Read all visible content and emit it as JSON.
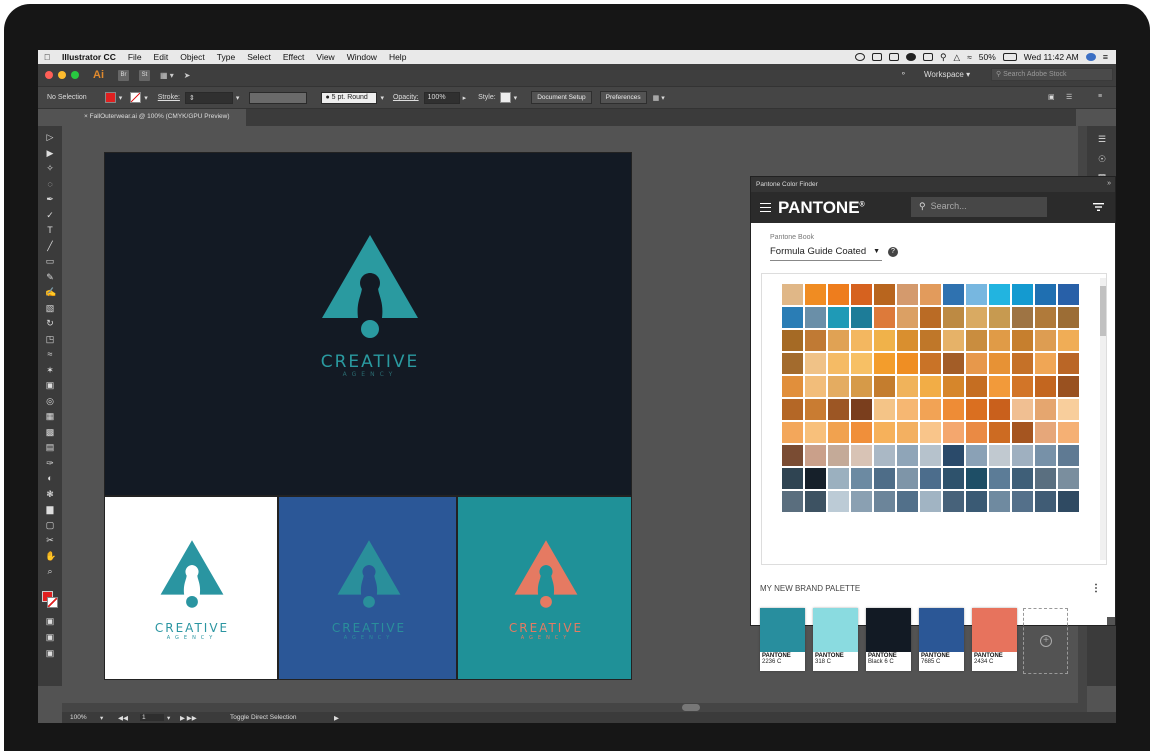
{
  "menubar": {
    "app": "Illustrator CC",
    "items": [
      "File",
      "Edit",
      "Object",
      "Type",
      "Select",
      "Effect",
      "View",
      "Window",
      "Help"
    ],
    "battery": "50%",
    "clock": "Wed 11:42 AM"
  },
  "appbar": {
    "logo": "Ai",
    "icons": [
      "Br",
      "St"
    ],
    "workspace": "Workspace",
    "search_placeholder": "Search Adobe Stock"
  },
  "control": {
    "selection": "No Selection",
    "stroke_label": "Stroke:",
    "brush": "5 pt. Round",
    "opacity_label": "Opacity:",
    "opacity_value": "100%",
    "style_label": "Style:",
    "doc_setup": "Document Setup",
    "preferences": "Preferences",
    "fill_color": "#e02020"
  },
  "doc_tab": "FallOuterwear.ai @ 100% (CMYK/GPU Preview)",
  "status": {
    "zoom": "100%",
    "page": "1",
    "tool": "Toggle Direct Selection"
  },
  "logo": {
    "word": "CREATIVE",
    "sub": "AGENCY"
  },
  "artboards": {
    "main_bg": "#131a24",
    "main_logo": "#2a9aa0",
    "variants": [
      {
        "bg": "#ffffff",
        "logo": "#2a95a1"
      },
      {
        "bg": "#2b5797",
        "logo": "#2a8f9b"
      },
      {
        "bg": "#1f9198",
        "logo": "#e57a62"
      }
    ]
  },
  "pantone": {
    "panel_title": "Pantone Color Finder",
    "brand": "PANTONE",
    "search_placeholder": "Search...",
    "book_label": "Pantone Book",
    "book_value": "Formula Guide Coated",
    "palette_title": "MY NEW BRAND PALETTE",
    "palette": [
      {
        "brand": "PANTONE",
        "code": "2236 C",
        "color": "#288e9e"
      },
      {
        "brand": "PANTONE",
        "code": "318 C",
        "color": "#8adbe0"
      },
      {
        "brand": "PANTONE",
        "code": "Black 6 C",
        "color": "#121a24"
      },
      {
        "brand": "PANTONE",
        "code": "7685 C",
        "color": "#2b5796"
      },
      {
        "brand": "PANTONE",
        "code": "2434 C",
        "color": "#e7735d"
      }
    ],
    "swatch_rows": [
      [
        "#e0b787",
        "#f08c22",
        "#ee7d1d",
        "#d6621f",
        "#b8651e",
        "#d49a6d",
        "#e29b5c",
        "#2f72b0",
        "#77b7e0",
        "#22b4e0",
        "#149ad0",
        "#1f6fb1",
        "#2860a8"
      ],
      [
        "#2a7db5",
        "#6a8fa8",
        "#1f9ab6",
        "#1d7c98",
        "#dd7a3a",
        "#dba064",
        "#ba6b25",
        "#bd8a43",
        "#d9aa62",
        "#c79a50",
        "#9e7444",
        "#b07a3a",
        "#9c6d35"
      ],
      [
        "#a56a25",
        "#c07a34",
        "#e0a254",
        "#f3b760",
        "#f0b24a",
        "#d98f2f",
        "#bf7729",
        "#e6b268",
        "#c98d3f",
        "#e09b47",
        "#c67f2e",
        "#dd9d52",
        "#f0ad56"
      ],
      [
        "#a36b2d",
        "#f0c287",
        "#f5bb65",
        "#f7c065",
        "#f39d2c",
        "#ef8e23",
        "#c97327",
        "#a35d27",
        "#e7984b",
        "#e79235",
        "#c57128",
        "#f0a655",
        "#ba6626"
      ],
      [
        "#e18f3b",
        "#f2bd7a",
        "#e4ac61",
        "#d69a48",
        "#c47d2e",
        "#f0b35b",
        "#f2ad46",
        "#d6862b",
        "#c56e22",
        "#f29a3a",
        "#d27528",
        "#c3661f",
        "#995120"
      ],
      [
        "#b46726",
        "#c97c32",
        "#9c5624",
        "#7a3e1d",
        "#f4c487",
        "#f6b772",
        "#f2a355",
        "#ee8c36",
        "#da6f20",
        "#c9601c",
        "#f0bf92",
        "#e5a66f",
        "#f8ce9c"
      ],
      [
        "#f3a75b",
        "#f8c07b",
        "#f1a24f",
        "#f08f3a",
        "#f6b15b",
        "#f3b061",
        "#f9c58a",
        "#f4a76e",
        "#ea8a44",
        "#cd6b22",
        "#a55520",
        "#e6a77a",
        "#f5b074"
      ],
      [
        "#7a4c33",
        "#caa08a",
        "#c4aa98",
        "#d8c3b5",
        "#aab8c5",
        "#8fa5b8",
        "#b6c2cc",
        "#2a4a6a",
        "#8aa1b6",
        "#c1c9d0",
        "#9fb0c0",
        "#7791a8",
        "#5f7a93"
      ],
      [
        "#2f4452",
        "#16202a",
        "#9bb0bf",
        "#6c8aa2",
        "#4e6d88",
        "#7e95a8",
        "#4c6d8c",
        "#2e526c",
        "#1e4e66",
        "#5c7c97",
        "#3f5f78",
        "#5a6f80",
        "#7a8e9e"
      ],
      [
        "#5a6e7e",
        "#3d5262",
        "#bccbd6",
        "#8aa0b2",
        "#6c859a",
        "#52708a",
        "#a1b4c3",
        "#47627a",
        "#3a5a74",
        "#6f8aa0",
        "#54708a",
        "#405c75",
        "#2f4a62"
      ]
    ]
  }
}
